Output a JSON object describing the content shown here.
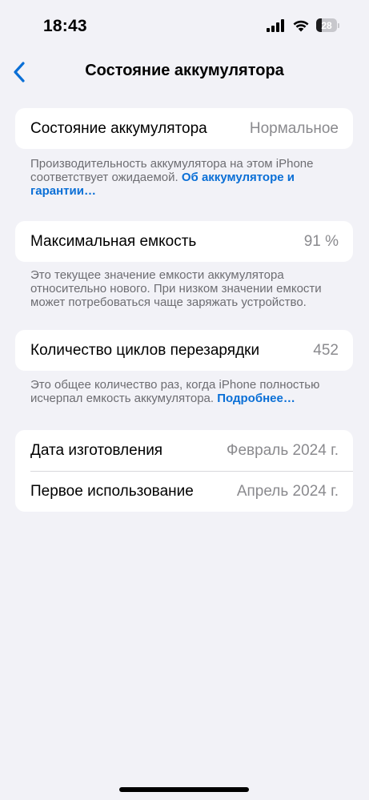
{
  "status_bar": {
    "time": "18:43",
    "battery_level": "28",
    "battery_fraction": 0.28
  },
  "nav": {
    "title": "Состояние аккумулятора",
    "back_icon": "chevron-left-icon",
    "accent_color": "#0a6fd6"
  },
  "health": {
    "label": "Состояние аккумулятора",
    "value": "Нормальное",
    "footnote": "Производительность аккумулятора на этом iPhone соответствует ожидаемой.",
    "footnote_link": "Об аккумуляторе и гарантии…"
  },
  "capacity": {
    "label": "Максимальная емкость",
    "value": "91 %",
    "footnote": "Это текущее значение емкости аккумулятора относительно нового. При низком значении емкости может потребоваться чаще заряжать устройство."
  },
  "cycles": {
    "label": "Количество циклов перезарядки",
    "value": "452",
    "footnote": "Это общее количество раз, когда iPhone полностью исчерпал емкость аккумулятора.",
    "footnote_link": "Подробнее…"
  },
  "dates": {
    "manufacture_label": "Дата изготовления",
    "manufacture_value": "Февраль 2024 г.",
    "first_use_label": "Первое использование",
    "first_use_value": "Апрель 2024 г."
  }
}
